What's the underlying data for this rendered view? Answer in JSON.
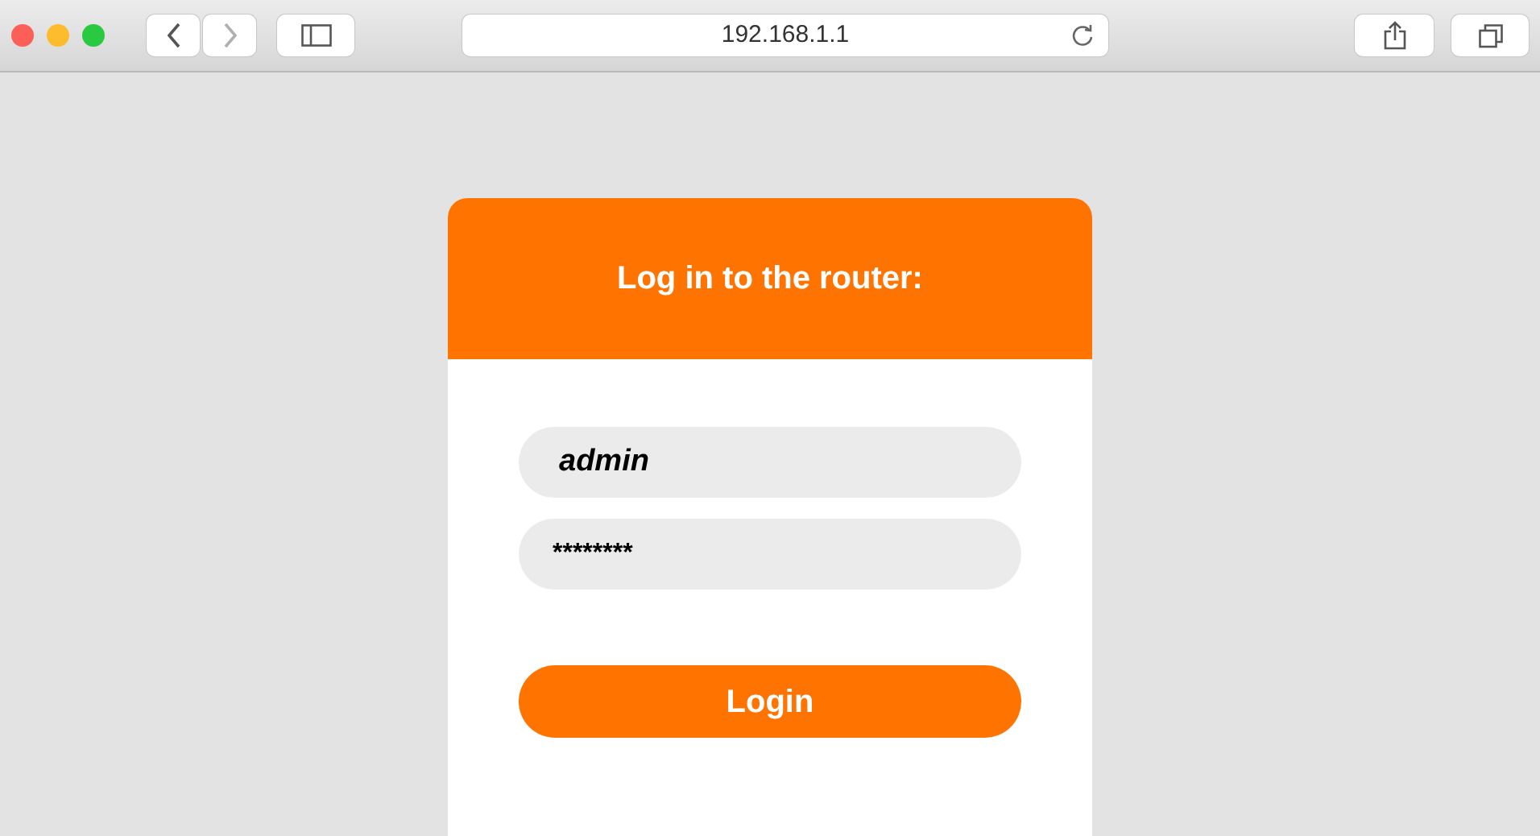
{
  "browser": {
    "address": "192.168.1.1",
    "nav_buttons": [
      {
        "kind": "back",
        "disabled": false
      },
      {
        "kind": "forward",
        "disabled": true
      }
    ]
  },
  "login": {
    "title": "Log in to the router:",
    "username": "admin",
    "password": "********",
    "button": "Login"
  }
}
